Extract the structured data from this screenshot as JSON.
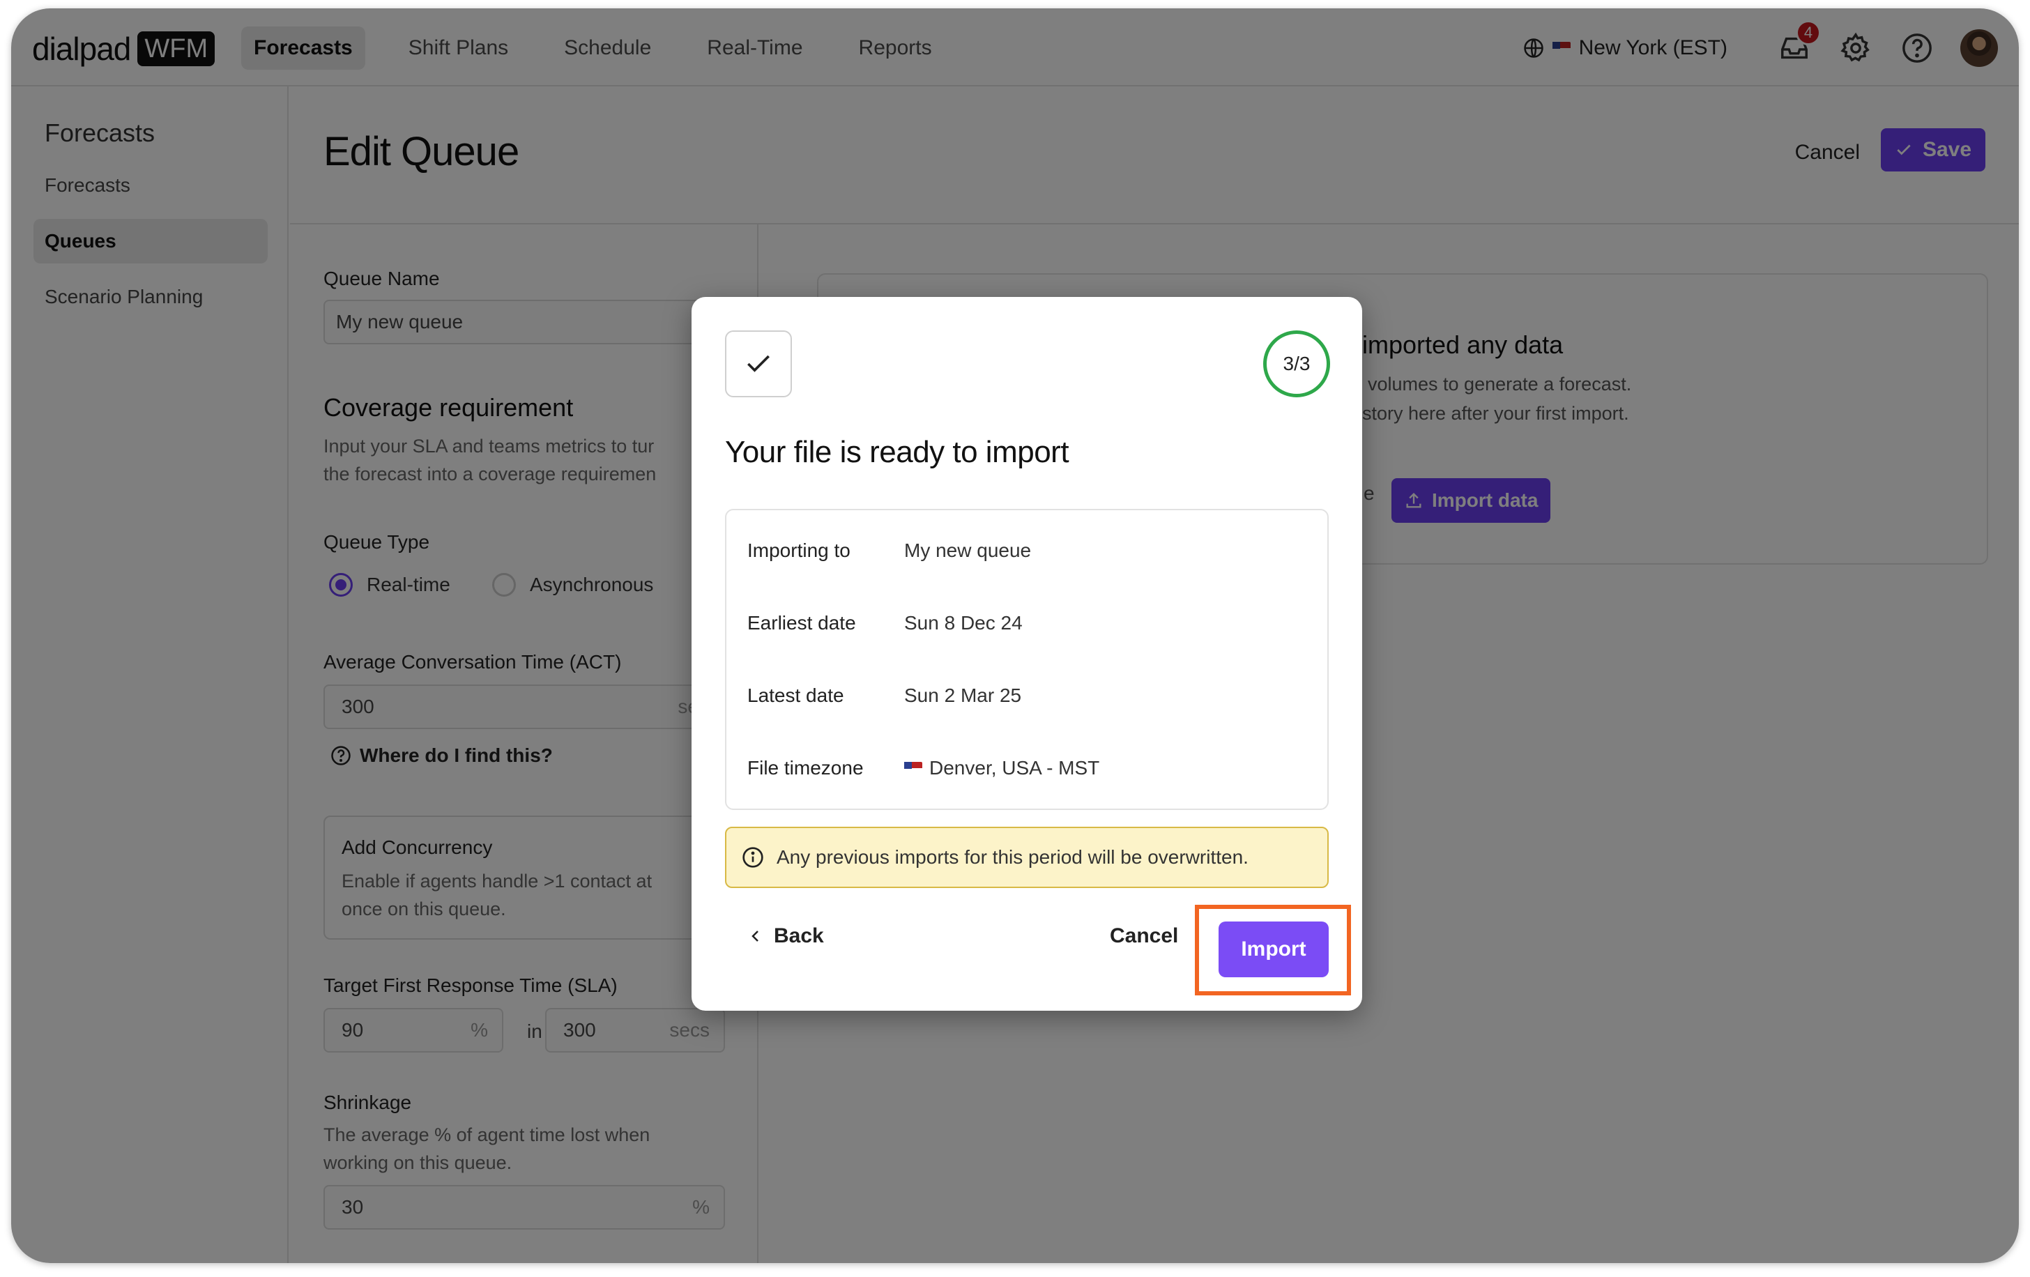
{
  "brand": {
    "name": "dialpad",
    "product": "WFM"
  },
  "nav": [
    "Forecasts",
    "Shift Plans",
    "Schedule",
    "Real-Time",
    "Reports"
  ],
  "topbar": {
    "timezone": "New York (EST)",
    "notifications": "4"
  },
  "sidebar": {
    "title": "Forecasts",
    "items": [
      "Forecasts",
      "Queues",
      "Scenario Planning"
    ]
  },
  "page": {
    "title": "Edit Queue",
    "cancel": "Cancel",
    "save": "Save"
  },
  "form": {
    "queue_name_label": "Queue Name",
    "queue_name_value": "My new queue",
    "coverage_title": "Coverage requirement",
    "coverage_desc_1": "Input your SLA and teams metrics to tur",
    "coverage_desc_2": "the forecast into a coverage requiremen",
    "queue_type_label": "Queue Type",
    "queue_type_options": [
      "Real-time",
      "Asynchronous"
    ],
    "act_label": "Average Conversation Time (ACT)",
    "act_value": "300",
    "act_unit": "se",
    "help_link": "Where do I find this?",
    "concurrency_title": "Add Concurrency",
    "concurrency_desc_1": "Enable if agents handle >1 contact at",
    "concurrency_desc_2": "once on this queue.",
    "sla_label": "Target First Response Time (SLA)",
    "sla_percent": "90",
    "sla_percent_unit": "%",
    "sla_in": "in",
    "sla_secs": "300",
    "sla_secs_unit": "secs",
    "shrinkage_label": "Shrinkage",
    "shrinkage_desc_1": "The average % of agent time lost when",
    "shrinkage_desc_2": "working on this queue.",
    "shrinkage_value": "30",
    "shrinkage_unit": "%"
  },
  "empty_state": {
    "title": "imported any data",
    "desc_1": "volumes to generate a forecast.",
    "desc_2": "story here after your first import.",
    "partial": "e",
    "button": "Import data"
  },
  "modal": {
    "step": "3/3",
    "title": "Your file is ready to import",
    "rows": [
      {
        "key": "Importing to",
        "value": "My new queue"
      },
      {
        "key": "Earliest date",
        "value": "Sun 8 Dec 24"
      },
      {
        "key": "Latest date",
        "value": "Sun 2 Mar 25"
      },
      {
        "key": "File timezone",
        "value": "Denver, USA - MST"
      }
    ],
    "warning": "Any previous imports for this period will be overwritten.",
    "back": "Back",
    "cancel": "Cancel",
    "import": "Import"
  },
  "colors": {
    "accent": "#6b3ef0",
    "step_ring": "#2ea84a",
    "warning_bg": "#fcf3c9",
    "highlight": "#f26522"
  }
}
